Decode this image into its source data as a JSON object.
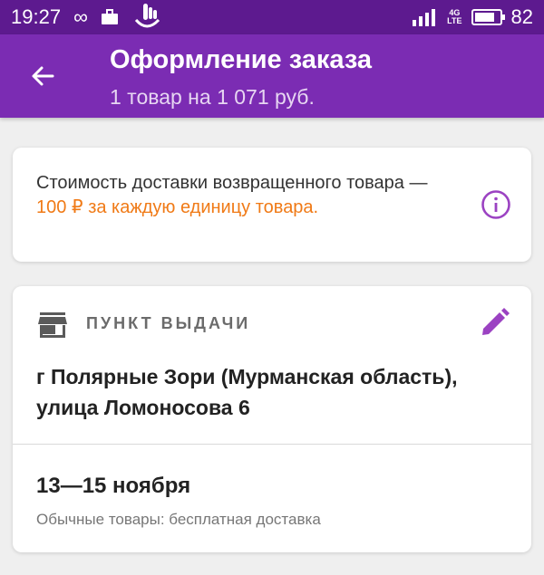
{
  "status_bar": {
    "time": "19:27",
    "network_top": "4G",
    "network_bottom": "LTE",
    "battery_level": "82",
    "battery_fraction": 0.82
  },
  "header": {
    "title": "Оформление заказа",
    "subtitle": "1 товар на 1 071 руб."
  },
  "info_card": {
    "line": "Стоимость доставки возвращенного товара —",
    "highlight": "100 ₽ за каждую единицу товара."
  },
  "pickup_card": {
    "label": "ПУНКТ ВЫДАЧИ",
    "address": "г Полярные Зори (Мурманская область), улица Ломоносова 6",
    "dates": "13—15 ноября",
    "note": "Обычные товары: бесплатная доставка"
  },
  "colors": {
    "status_bar": "#5d1a8f",
    "app_bar": "#7b2cb3",
    "accent": "#9b42c2",
    "highlight": "#f07a16"
  }
}
